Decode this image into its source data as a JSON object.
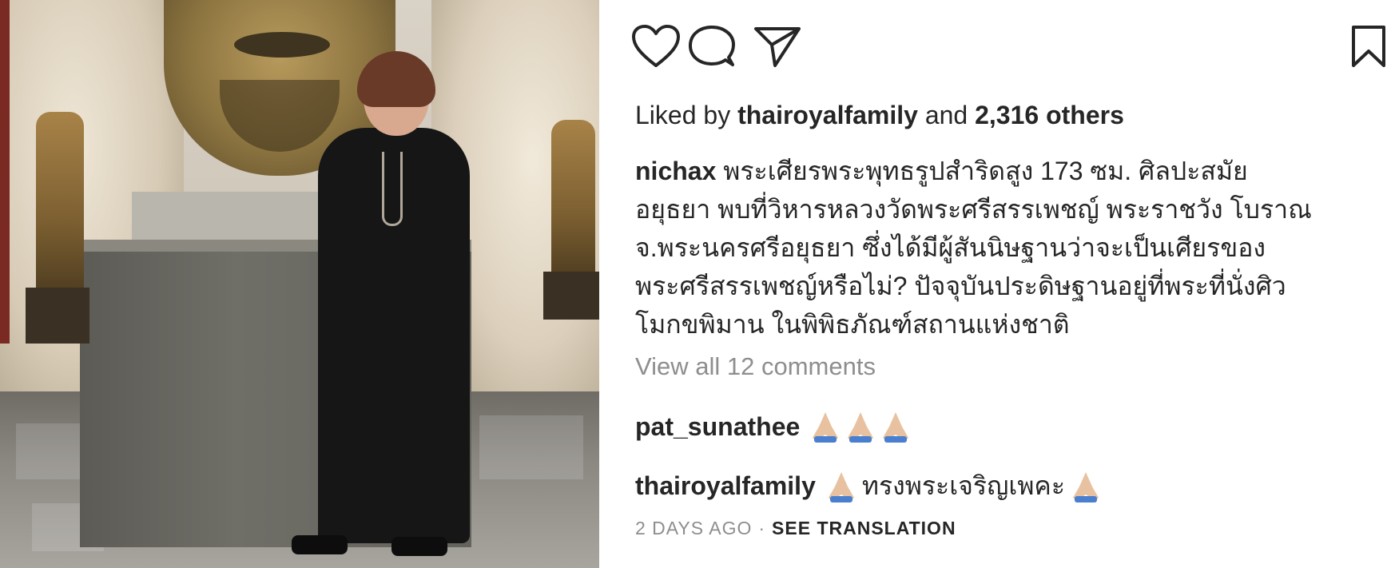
{
  "post": {
    "icons": {
      "like": "heart-icon",
      "comment": "comment-bubble-icon",
      "share": "paper-plane-icon",
      "save": "bookmark-icon"
    },
    "likes": {
      "prefix": "Liked by",
      "user": "thairoyalfamily",
      "joiner": "and",
      "others": "2,316 others"
    },
    "caption": {
      "user": "nichax",
      "lines": [
        "พระเศียรพระพุทธรูปสำริดสูง 173 ซม. ศิลปะสมัย",
        "อยุธยา พบที่วิหารหลวงวัดพระศรีสรรเพชญ์ พระราชวัง โบราณ",
        "จ.พระนครศรีอยุธยา ซึ่งได้มีผู้สันนิษฐานว่าจะเป็นเศียรของ",
        "พระศรีสรรเพชญ์หรือไม่? ปัจจุบันประดิษฐานอยู่ที่พระที่นั่งศิว",
        "โมกขพิมาน ในพิพิธภัณฑ์สถานแห่งชาติ"
      ]
    },
    "view_all_comments": "View all 12 comments",
    "comments": [
      {
        "user": "pat_sunathee",
        "before": "",
        "after": "",
        "emoji_count_before": 3,
        "emoji": "folded-hands-icon"
      },
      {
        "user": "thairoyalfamily",
        "text": "ทรงพระเจริญเพคะ",
        "emoji": "folded-hands-icon"
      }
    ],
    "footer": {
      "timestamp": "2 DAYS AGO",
      "separator": "·",
      "see_translation": "SEE TRANSLATION"
    },
    "colors": {
      "text": "#262626",
      "muted": "#8e8e8e",
      "background": "#ffffff"
    }
  }
}
